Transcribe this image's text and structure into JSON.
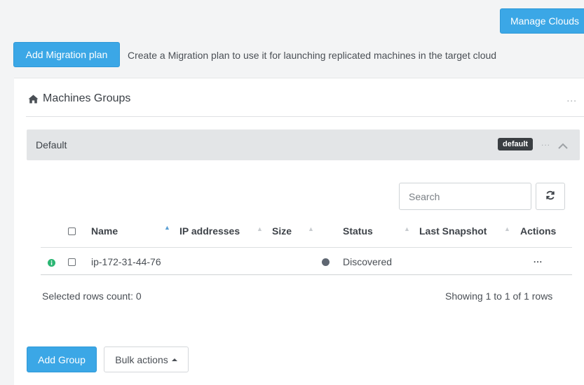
{
  "toolbar": {
    "manage_clouds_label": "Manage Clouds",
    "add_migration_label": "Add Migration plan",
    "migration_description": "Create a Migration plan to use it for launching replicated machines in the target cloud"
  },
  "panel": {
    "title": "Machines Groups",
    "icon": "home-icon",
    "menu_label": "..."
  },
  "group": {
    "name": "Default",
    "badge": "default",
    "menu_label": "...",
    "chevron_icon": "chevron-up-icon"
  },
  "table": {
    "search_placeholder": "Search",
    "refresh_icon": "refresh-icon",
    "columns": [
      "Name",
      "IP addresses",
      "Size",
      "Status",
      "Last Snapshot",
      "Actions"
    ],
    "rows": [
      {
        "name": "ip-172-31-44-76",
        "ip_addresses": "",
        "size": "",
        "status": "Discovered",
        "last_snapshot": "",
        "actions": "..."
      }
    ],
    "selected_rows": "Selected rows count: 0",
    "showing": "Showing 1 to 1 of 1 rows"
  },
  "footer": {
    "add_group_label": "Add Group",
    "bulk_actions_label": "Bulk actions"
  },
  "colors": {
    "primary": "#3ba7e6",
    "info_icon": "#2bb673",
    "status_dot": "#5f6772",
    "badge_bg": "#3a3e42"
  }
}
